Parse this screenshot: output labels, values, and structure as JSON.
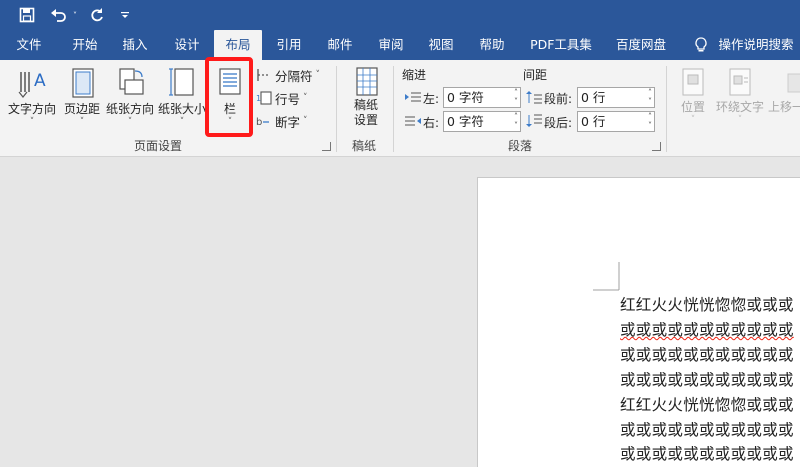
{
  "quick_access": {
    "save_icon": "save-icon",
    "undo_icon": "undo-icon",
    "redo_icon": "redo-icon"
  },
  "tabs": [
    "文件",
    "开始",
    "插入",
    "设计",
    "布局",
    "引用",
    "邮件",
    "审阅",
    "视图",
    "帮助",
    "PDF工具集",
    "百度网盘"
  ],
  "active_tab": "布局",
  "tell_me": "操作说明搜索",
  "page_setup": {
    "text_direction": "文字方向",
    "margins": "页边距",
    "orientation": "纸张方向",
    "size": "纸张大小",
    "columns": "栏",
    "breaks": "分隔符",
    "line_numbers": "行号",
    "hyphenation": "断字",
    "group_label": "页面设置"
  },
  "manuscript": {
    "button": "稿纸\n设置",
    "btn_line1": "稿纸",
    "btn_line2": "设置",
    "group_label": "稿纸"
  },
  "paragraph": {
    "indent_title": "缩进",
    "spacing_title": "间距",
    "left_label": "左:",
    "right_label": "右:",
    "left_value": "0 字符",
    "right_value": "0 字符",
    "before_label": "段前:",
    "after_label": "段后:",
    "before_value": "0 行",
    "after_value": "0 行",
    "group_label": "段落"
  },
  "arrange": {
    "position": "位置",
    "wrap_text": "环绕文字",
    "bring_forward": "上移一"
  },
  "document_lines": [
    "红红火火恍恍惚惚或或或",
    "或或或或或或或或或或或",
    "或或或或或或或或或或或",
    "或或或或或或或或或或或",
    "红红火火恍恍惚惚或或或",
    "或或或或或或或或或或或",
    "或或或或或或或或或或或"
  ],
  "colors": {
    "accent": "#2b579a",
    "highlight": "#ff1a1a"
  }
}
